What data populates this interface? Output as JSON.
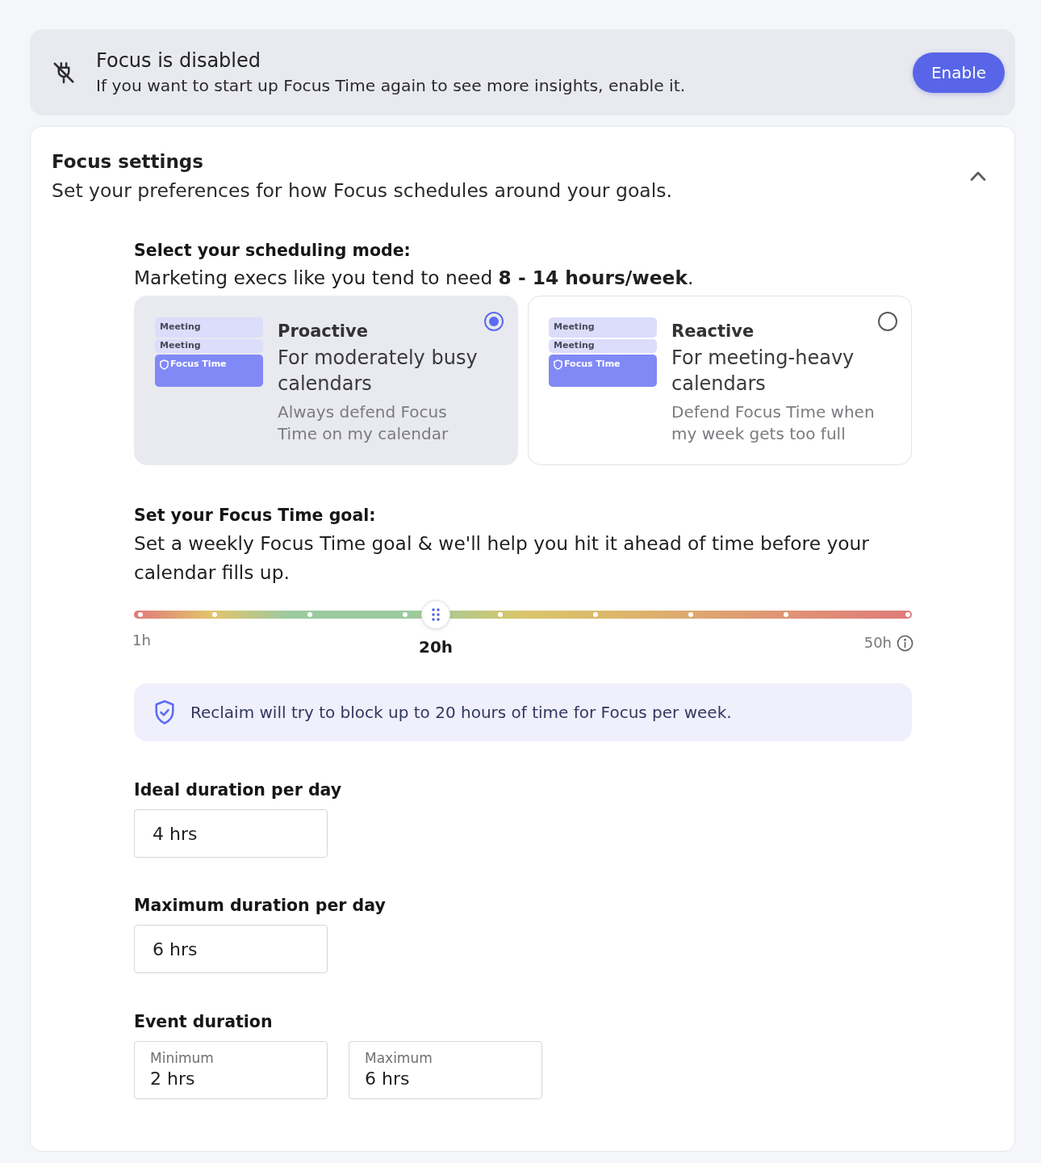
{
  "banner": {
    "title": "Focus is disabled",
    "message": "If you want to start up Focus Time again to see more insights, enable it.",
    "button": "Enable"
  },
  "settings": {
    "title": "Focus settings",
    "subtitle": "Set your preferences for how Focus schedules around your goals.",
    "expanded": true
  },
  "scheduling": {
    "heading": "Select your scheduling mode:",
    "hint": "Marketing execs like you tend to need **8 - 14 hours/week**.",
    "modes": [
      {
        "title": "Proactive",
        "subtitle": "For moderately busy calendars",
        "description": "Always defend Focus Time on my calendar",
        "selected": true,
        "events": [
          {
            "kind": "meeting",
            "label": "Meeting"
          },
          {
            "kind": "meeting",
            "label": "Meeting"
          },
          {
            "kind": "focus",
            "label": "Focus Time"
          }
        ]
      },
      {
        "title": "Reactive",
        "subtitle": "For meeting-heavy calendars",
        "description": "Defend Focus Time when my week gets too full",
        "selected": false,
        "events": [
          {
            "kind": "meeting",
            "label": "Meeting"
          },
          {
            "kind": "meeting",
            "label": "Meeting"
          },
          {
            "kind": "focus",
            "label": "Focus Time"
          }
        ]
      }
    ]
  },
  "goal": {
    "heading": "Set your Focus Time goal:",
    "description": "Set a weekly Focus Time goal & we'll help you hit it ahead of time before your calendar fills up.",
    "slider": {
      "min_label": "1h",
      "max_label": "50h",
      "value_label": "20h",
      "level": 0.388
    },
    "note": "Reclaim will try to block up to 20 hours of time for Focus per week."
  },
  "durations": [
    {
      "label": "Ideal duration per day",
      "value": "4 hrs"
    },
    {
      "label": "Maximum duration per day",
      "value": "6 hrs"
    }
  ],
  "event_duration": {
    "label": "Event duration",
    "fields": [
      {
        "label": "Minimum",
        "value": "2 hrs"
      },
      {
        "label": "Maximum",
        "value": "6 hrs"
      }
    ]
  }
}
